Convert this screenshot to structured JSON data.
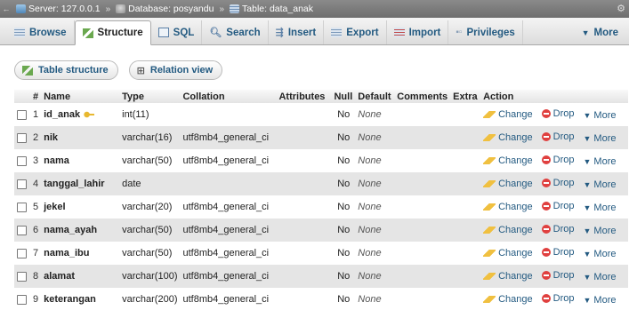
{
  "breadcrumb": {
    "server": "Server: 127.0.0.1",
    "database": "Database: posyandu",
    "table": "Table: data_anak",
    "separator": "»"
  },
  "tabs": [
    {
      "label": "Browse",
      "icon": "browse-icon",
      "active": false
    },
    {
      "label": "Structure",
      "icon": "structure-icon",
      "active": true
    },
    {
      "label": "SQL",
      "icon": "sql-icon",
      "active": false
    },
    {
      "label": "Search",
      "icon": "search-icon",
      "active": false
    },
    {
      "label": "Insert",
      "icon": "insert-icon",
      "active": false
    },
    {
      "label": "Export",
      "icon": "export-icon",
      "active": false
    },
    {
      "label": "Import",
      "icon": "import-icon",
      "active": false
    },
    {
      "label": "Privileges",
      "icon": "privileges-icon",
      "active": false
    }
  ],
  "more_tab": "More",
  "subtabs": {
    "table_structure": "Table structure",
    "relation_view": "Relation view"
  },
  "columns": {
    "num": "#",
    "name": "Name",
    "type": "Type",
    "collation": "Collation",
    "attributes": "Attributes",
    "null": "Null",
    "default": "Default",
    "comments": "Comments",
    "extra": "Extra",
    "action": "Action"
  },
  "actions": {
    "change": "Change",
    "drop": "Drop",
    "more": "More"
  },
  "rows": [
    {
      "num": "1",
      "name": "id_anak",
      "type": "int(11)",
      "collation": "",
      "null": "No",
      "default": "None",
      "primary": true
    },
    {
      "num": "2",
      "name": "nik",
      "type": "varchar(16)",
      "collation": "utf8mb4_general_ci",
      "null": "No",
      "default": "None"
    },
    {
      "num": "3",
      "name": "nama",
      "type": "varchar(50)",
      "collation": "utf8mb4_general_ci",
      "null": "No",
      "default": "None"
    },
    {
      "num": "4",
      "name": "tanggal_lahir",
      "type": "date",
      "collation": "",
      "null": "No",
      "default": "None"
    },
    {
      "num": "5",
      "name": "jekel",
      "type": "varchar(20)",
      "collation": "utf8mb4_general_ci",
      "null": "No",
      "default": "None"
    },
    {
      "num": "6",
      "name": "nama_ayah",
      "type": "varchar(50)",
      "collation": "utf8mb4_general_ci",
      "null": "No",
      "default": "None"
    },
    {
      "num": "7",
      "name": "nama_ibu",
      "type": "varchar(50)",
      "collation": "utf8mb4_general_ci",
      "null": "No",
      "default": "None"
    },
    {
      "num": "8",
      "name": "alamat",
      "type": "varchar(100)",
      "collation": "utf8mb4_general_ci",
      "null": "No",
      "default": "None"
    },
    {
      "num": "9",
      "name": "keterangan",
      "type": "varchar(200)",
      "collation": "utf8mb4_general_ci",
      "null": "No",
      "default": "None"
    }
  ],
  "colors": {
    "link": "#235a81",
    "row_alt": "#e5e5e5",
    "drop": "#e0403f",
    "key": "#e8b830"
  }
}
